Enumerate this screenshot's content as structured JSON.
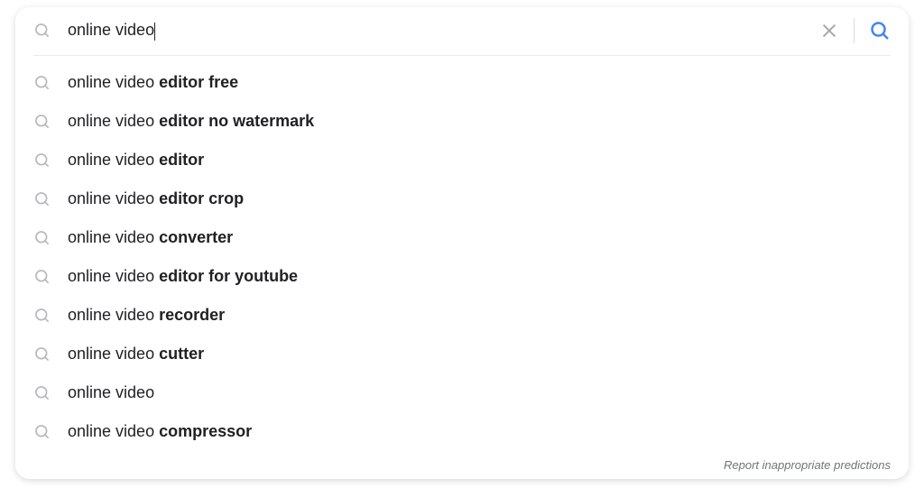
{
  "search": {
    "query": "online video",
    "placeholder": ""
  },
  "suggestions": [
    {
      "prefix": "online video ",
      "completion": "editor free"
    },
    {
      "prefix": "online video ",
      "completion": "editor no watermark"
    },
    {
      "prefix": "online video ",
      "completion": "editor"
    },
    {
      "prefix": "online video ",
      "completion": "editor crop"
    },
    {
      "prefix": "online video ",
      "completion": "converter"
    },
    {
      "prefix": "online video ",
      "completion": "editor for youtube"
    },
    {
      "prefix": "online video ",
      "completion": "recorder"
    },
    {
      "prefix": "online video ",
      "completion": "cutter"
    },
    {
      "prefix": "online video",
      "completion": ""
    },
    {
      "prefix": "online video ",
      "completion": "compressor"
    }
  ],
  "footer": {
    "report_label": "Report inappropriate predictions"
  }
}
